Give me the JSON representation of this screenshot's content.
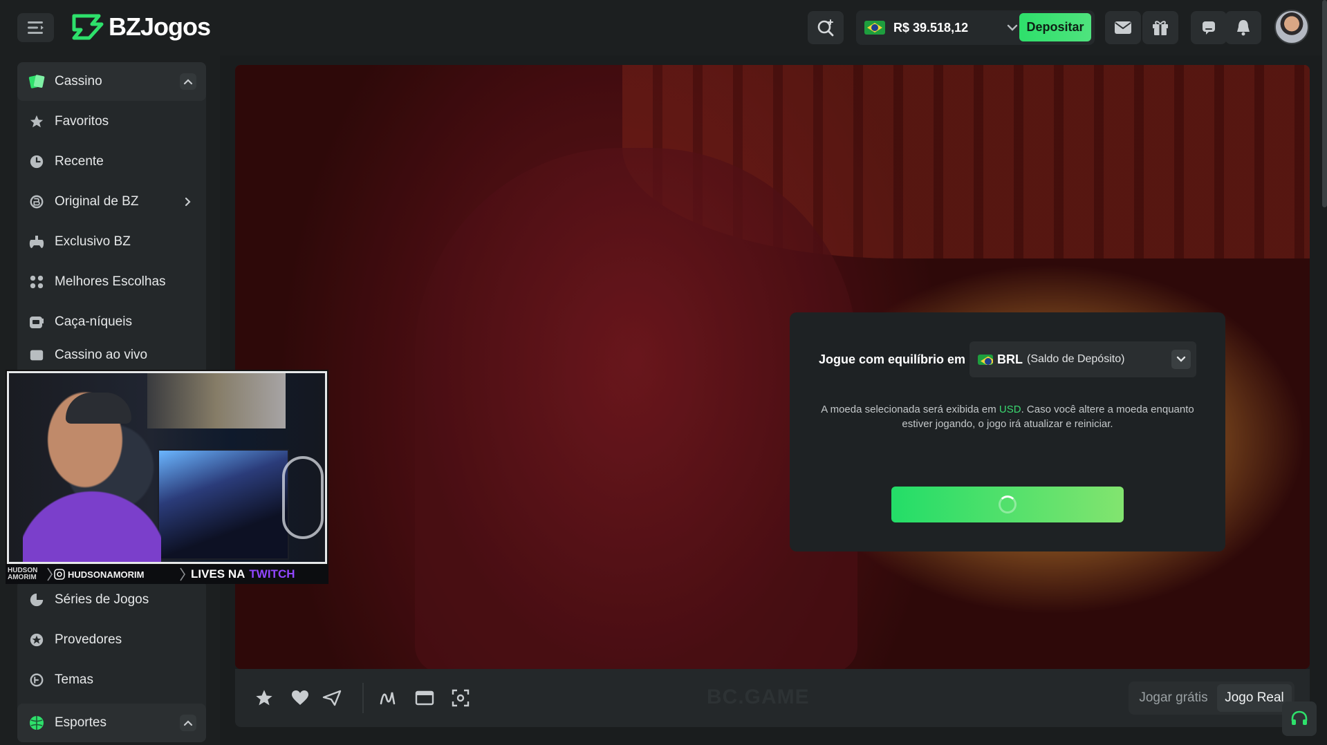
{
  "header": {
    "logo_text": "BZJogos",
    "balance": "R$ 39.518,12",
    "deposit_label": "Depositar"
  },
  "sidebar": {
    "items": [
      {
        "label": "Cassino"
      },
      {
        "label": "Favoritos"
      },
      {
        "label": "Recente"
      },
      {
        "label": "Original de BZ"
      },
      {
        "label": "Exclusivo BZ"
      },
      {
        "label": "Melhores Escolhas"
      },
      {
        "label": "Caça-níqueis"
      },
      {
        "label": "Cassino ao vivo"
      },
      {
        "label": "Séries de Jogos"
      },
      {
        "label": "Provedores"
      },
      {
        "label": "Temas"
      },
      {
        "label": "Esportes"
      }
    ]
  },
  "modal": {
    "label": "Jogue com equilíbrio em",
    "currency_code": "BRL",
    "currency_sub": "(Saldo de Depósito)",
    "msg_before": "A moeda selecionada será exibida em ",
    "msg_usd": "USD",
    "msg_after": ". Caso você altere a moeda enquanto estiver jogando, o jogo irá atualizar e reiniciar."
  },
  "game_bar": {
    "watermark": "BC.GAME",
    "free_label": "Jogar grátis",
    "real_label": "Jogo Real"
  },
  "webcam": {
    "name": "HUDSON AMORIM",
    "handle": "HUDSONAMORIM",
    "lives": "LIVES NA",
    "twitch": "TWITCH"
  },
  "colors": {
    "accent_green": "#2ee06b",
    "usd_green": "#3bd870",
    "twitch_purple": "#9146ff"
  }
}
